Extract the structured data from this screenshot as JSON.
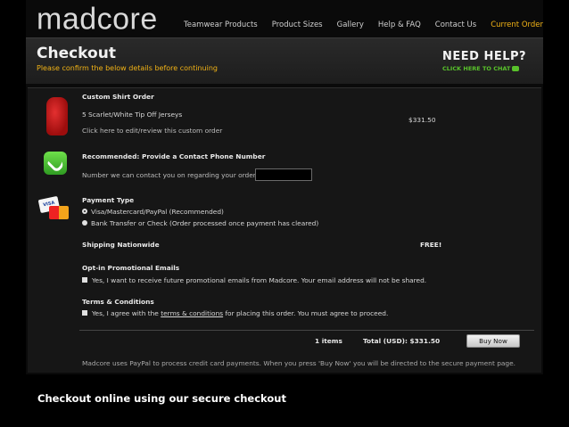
{
  "brand": {
    "logo_text": "madcore",
    "logo_mark": "®"
  },
  "nav": {
    "items": [
      "Teamwear Products",
      "Product Sizes",
      "Gallery",
      "Help & FAQ",
      "Contact Us"
    ],
    "current": "Current Order"
  },
  "header": {
    "title": "Checkout",
    "subtitle": "Please confirm the below details before continuing",
    "help_title": "NEED HELP?",
    "help_link": "CLICK HERE TO CHAT"
  },
  "order": {
    "heading": "Custom Shirt Order",
    "item": "5 Scarlet/White Tip Off Jerseys",
    "edit_link": "Click here to edit/review this custom order",
    "price": "$331.50"
  },
  "contact": {
    "heading": "Recommended: Provide a Contact Phone Number",
    "label": "Number we can contact you on regarding your order:",
    "value": ""
  },
  "payment": {
    "heading": "Payment Type",
    "card_text": "VISA",
    "options": [
      {
        "label": "Visa/Mastercard/PayPal (Recommended)",
        "selected": true
      },
      {
        "label": "Bank Transfer or Check (Order processed once payment has cleared)",
        "selected": false
      }
    ]
  },
  "shipping": {
    "label": "Shipping Nationwide",
    "value": "FREE!"
  },
  "promo": {
    "heading": "Opt-in Promotional Emails",
    "checkbox_label": "Yes, I want to receive future promotional emails from Madcore. Your email address will not be shared."
  },
  "terms": {
    "heading": "Terms & Conditions",
    "prefix": "Yes, I agree with the ",
    "link": "terms & conditions",
    "suffix": " for placing this order. You must agree to proceed."
  },
  "summary": {
    "items": "1 items",
    "total": "Total (USD): $331.50",
    "buy_label": "Buy Now"
  },
  "footer_note": "Madcore uses PayPal to process credit card payments. When you press 'Buy Now' you will be directed to the secure payment page.",
  "caption": "Checkout online using our secure checkout",
  "colors": {
    "accent": "#f2b316",
    "chat": "#59c22b",
    "background": "#000000"
  }
}
